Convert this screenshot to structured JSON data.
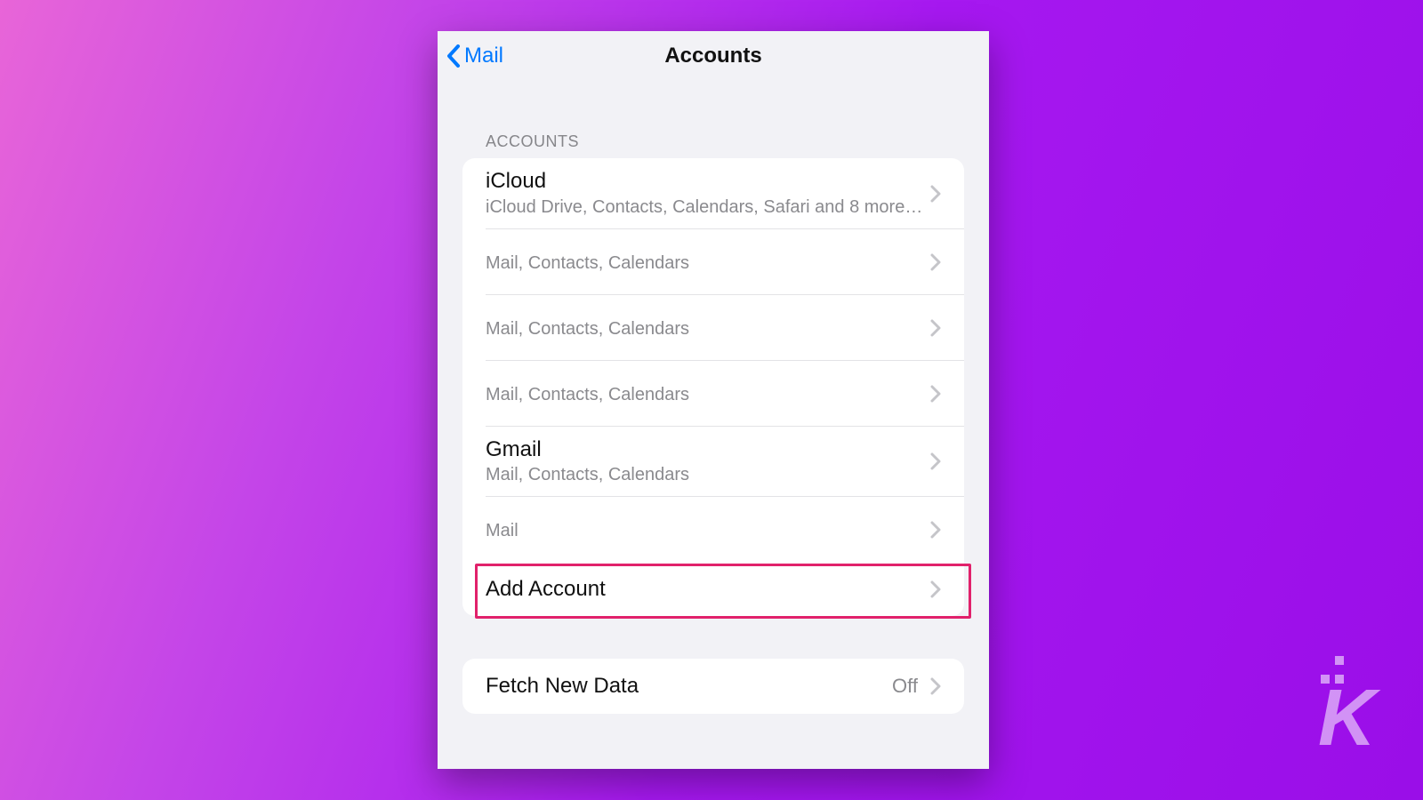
{
  "nav": {
    "back_label": "Mail",
    "title": "Accounts"
  },
  "section_header": "ACCOUNTS",
  "accounts": [
    {
      "title": "iCloud",
      "subtitle": "iCloud Drive, Contacts, Calendars, Safari and 8 more…"
    },
    {
      "title": "",
      "subtitle": "Mail, Contacts, Calendars"
    },
    {
      "title": "",
      "subtitle": "Mail, Contacts, Calendars"
    },
    {
      "title": "",
      "subtitle": "Mail, Contacts, Calendars"
    },
    {
      "title": "Gmail",
      "subtitle": "Mail, Contacts, Calendars"
    },
    {
      "title": "",
      "subtitle": "Mail"
    }
  ],
  "add_account_label": "Add Account",
  "fetch": {
    "label": "Fetch New Data",
    "value": "Off"
  },
  "colors": {
    "link": "#0079ff",
    "highlight": "#e1216b"
  }
}
